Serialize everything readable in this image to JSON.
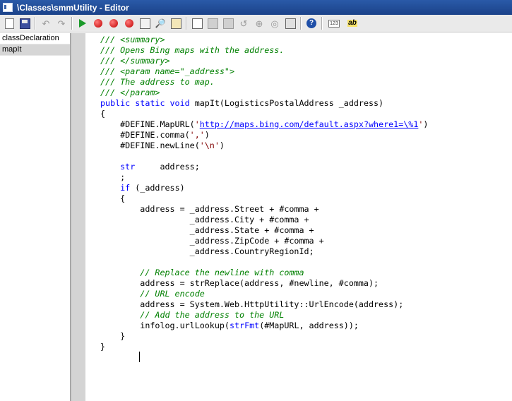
{
  "window": {
    "title": "\\Classes\\smmUtility - Editor"
  },
  "toolbar": {
    "icons": [
      "new-icon",
      "save-icon",
      "undo-icon",
      "redo-icon",
      "run-icon",
      "breakpoint-icon",
      "stop-breakpoint-icon",
      "remove-breakpoints-icon",
      "compile-icon",
      "lookup-icon",
      "script-icon",
      "source-control-icon",
      "comment-icon",
      "uncomment-icon",
      "indent-icon",
      "outdent-icon",
      "history-icon",
      "help-icon",
      "line-numbers-icon",
      "spell-check-icon"
    ],
    "line_numbers_label": "123",
    "spell_label": "ab"
  },
  "methods": [
    {
      "name": "classDeclaration",
      "selected": false
    },
    {
      "name": "mapIt",
      "selected": true
    }
  ],
  "code": {
    "l1": "/// <summary>",
    "l2": "/// Opens Bing maps with the address.",
    "l3": "/// </summary>",
    "l4": "/// <param name=\"_address\">",
    "l5": "/// The address to map.",
    "l6": "/// </param>",
    "l7_kw": "public static void",
    "l7_rest": " mapIt(LogisticsPostalAddress _address)",
    "l8": "{",
    "l9_pre": "    #DEFINE.MapURL(",
    "l9_q1": "'",
    "l9_url": "http://maps.bing.com/default.aspx?where1=\\%1",
    "l9_q2": "'",
    "l9_post": ")",
    "l10_pre": "    #DEFINE.comma(",
    "l10_str": "','",
    "l10_post": ")",
    "l11_pre": "    #DEFINE.newLine(",
    "l11_str": "'\\n'",
    "l11_post": ")",
    "l13_kw": "    str",
    "l13_rest": "     address;",
    "l14": "    ;",
    "l15_kw": "    if",
    "l15_rest": " (_address)",
    "l16": "    {",
    "l17": "        address = _address.Street + #comma +",
    "l18": "                  _address.City + #comma +",
    "l19": "                  _address.State + #comma +",
    "l20": "                  _address.ZipCode + #comma +",
    "l21": "                  _address.CountryRegionId;",
    "l23": "        // Replace the newline with comma",
    "l24": "        address = strReplace(address, #newline, #comma);",
    "l25": "        // URL encode",
    "l26": "        address = System.Web.HttpUtility::UrlEncode(address);",
    "l27": "        // Add the address to the URL",
    "l28_pre": "        infolog.urlLookup(",
    "l28_kw": "strFmt",
    "l28_post": "(#MapURL, address));",
    "l29": "    }",
    "l30": "}"
  }
}
